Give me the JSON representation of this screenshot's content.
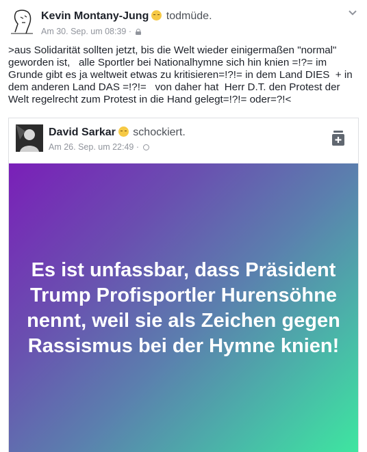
{
  "post": {
    "author": "Kevin Montany-Jung",
    "feeling": "todmüde.",
    "timestamp": "Am 30. Sep. um 08:39 ·",
    "text": ">aus Solidarität sollten jetzt, bis die Welt wieder einigermaßen \"normal\" geworden ist,   alle Sportler bei Nationalhymne sich hin knien =!?= im Grunde gibt es ja weltweit etwas zu kritisieren=!?!= in dem Land DIES  + in dem anderen Land DAS =!?!=   von daher hat  Herr D.T. den Protest der Welt regelrecht zum Protest in die Hand gelegt=!?!= oder=?!<"
  },
  "shared_post": {
    "author": "David Sarkar",
    "feeling": "schockiert.",
    "timestamp": "Am 26. Sep. um 22:49 ·",
    "text": "Es ist unfassbar, dass Präsident Trump Profisportler Hurensöhne nennt, weil sie als Zeichen gegen Rassismus bei der Hymne knien!"
  },
  "icons": {
    "privacy": "lock-icon",
    "shared_privacy": "globe-icon",
    "menu": "chevron-down-icon",
    "save": "save-icon"
  },
  "colors": {
    "gradient_start": "#7a1fb8",
    "gradient_end": "#3ee6a0",
    "meta_text": "#90949c"
  }
}
